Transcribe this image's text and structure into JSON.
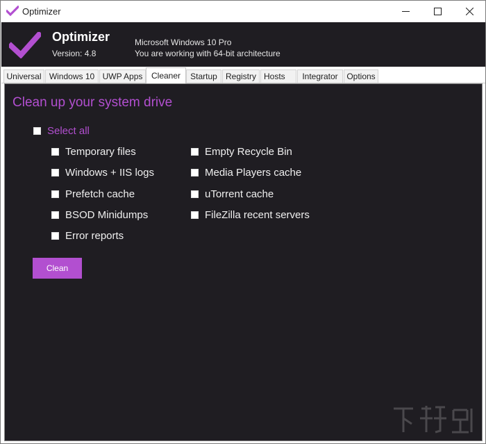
{
  "window": {
    "title": "Optimizer",
    "controls": {
      "minimize": "minimize",
      "maximize": "maximize",
      "close": "close"
    }
  },
  "header": {
    "app_name": "Optimizer",
    "version": "Version: 4.8",
    "os": "Microsoft Windows 10 Pro",
    "arch": "You are working with 64-bit architecture"
  },
  "tabs": [
    {
      "label": "Universal"
    },
    {
      "label": "Windows 10"
    },
    {
      "label": "UWP Apps"
    },
    {
      "label": "Cleaner"
    },
    {
      "label": "Startup"
    },
    {
      "label": "Registry"
    },
    {
      "label": "Hosts"
    },
    {
      "label": "Integrator"
    },
    {
      "label": "Options"
    }
  ],
  "active_tab": "Cleaner",
  "cleaner": {
    "title": "Clean up your system drive",
    "select_all": "Select all",
    "left_items": [
      {
        "label": "Temporary files",
        "checked": false
      },
      {
        "label": "Windows + IIS logs",
        "checked": false
      },
      {
        "label": "Prefetch cache",
        "checked": false
      },
      {
        "label": "BSOD Minidumps",
        "checked": false
      },
      {
        "label": "Error reports",
        "checked": false
      }
    ],
    "right_items": [
      {
        "label": "Empty Recycle Bin",
        "checked": false
      },
      {
        "label": "Media Players cache",
        "checked": false
      },
      {
        "label": "uTorrent cache",
        "checked": false
      },
      {
        "label": "FileZilla recent servers",
        "checked": false
      }
    ],
    "clean_button": "Clean"
  },
  "colors": {
    "accent": "#b24fd0",
    "background": "#1f1d22",
    "text": "#f0f0f0"
  },
  "icons": {
    "app": "checkmark-icon",
    "logo": "checkmark-icon"
  }
}
